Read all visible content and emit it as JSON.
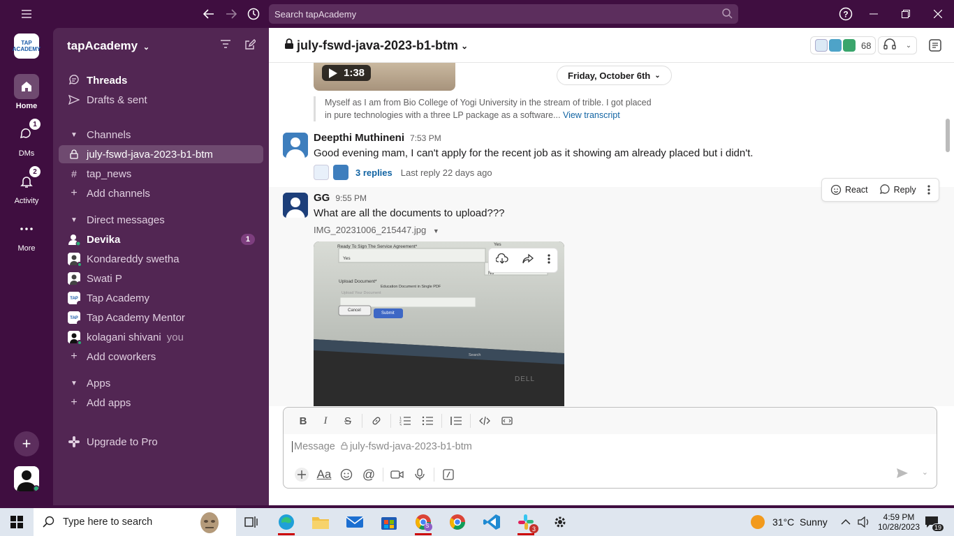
{
  "titlebar": {
    "search_placeholder": "Search tapAcademy"
  },
  "rail": {
    "workspace_logo_text": "TAP ACADEMY",
    "items": [
      {
        "label": "Home",
        "badge": ""
      },
      {
        "label": "DMs",
        "badge": "1"
      },
      {
        "label": "Activity",
        "badge": "2"
      },
      {
        "label": "More",
        "badge": ""
      }
    ]
  },
  "sidebar": {
    "workspace_name": "tapAcademy",
    "threads": "Threads",
    "drafts": "Drafts & sent",
    "channels_header": "Channels",
    "channels": [
      "july-fswd-java-2023-b1-btm",
      "tap_news"
    ],
    "add_channels": "Add channels",
    "dms_header": "Direct messages",
    "dms": [
      {
        "name": "Devika",
        "badge": "1",
        "suffix": ""
      },
      {
        "name": "Kondareddy swetha",
        "badge": "",
        "suffix": ""
      },
      {
        "name": "Swati P",
        "badge": "",
        "suffix": ""
      },
      {
        "name": "Tap Academy",
        "badge": "",
        "suffix": ""
      },
      {
        "name": "Tap Academy Mentor",
        "badge": "",
        "suffix": ""
      },
      {
        "name": "kolagani shivani",
        "badge": "",
        "suffix": "you"
      }
    ],
    "add_coworkers": "Add coworkers",
    "apps_header": "Apps",
    "add_apps": "Add apps",
    "upgrade": "Upgrade to Pro"
  },
  "channel": {
    "name": "july-fswd-java-2023-b1-btm",
    "member_count": "68"
  },
  "messages": {
    "video_duration": "1:38",
    "date_divider": "Friday, October 6th",
    "transcript_line1": "Myself as I am from Bio College of Yogi University in the stream of trible. I got placed",
    "transcript_line2": "in pure technologies with a three LP package as a software...",
    "transcript_link": "View transcript",
    "msg1": {
      "author": "Deepthi Muthineni",
      "time": "7:53 PM",
      "text": "Good evening mam, I can't apply for the recent job as it showing am already placed but i didn't.",
      "replies": "3 replies",
      "last_reply": "Last reply 22 days ago"
    },
    "msg2": {
      "author": "GG",
      "time": "9:55 PM",
      "text": "What are all the documents to upload???",
      "file": "IMG_20231006_215447.jpg"
    },
    "actions": {
      "react": "React",
      "reply": "Reply"
    }
  },
  "photo": {
    "line1": "Ready To Sign The Service Agreement*",
    "yes": "Yes",
    "yes_right": "Yes",
    "no": "No",
    "upload": "Upload Document*",
    "upload_hint": "Education Document in Single PDF",
    "upload_placeholder": "Upload Your Document",
    "cancel": "Cancel",
    "submit": "Submit",
    "search": "Search",
    "brand": "DELL"
  },
  "composer": {
    "placeholder": "Message",
    "channel": "july-fswd-java-2023-b1-btm"
  },
  "taskbar": {
    "search": "Type here to search",
    "weather": "31°C  Sunny",
    "time": "4:59 PM",
    "date": "10/28/2023",
    "notif": "19",
    "slack_badge": "3",
    "profile_badge": "S"
  },
  "colors": {
    "aubergine": "#3f0e40",
    "sidebar": "#522653",
    "link": "#1264a3"
  }
}
